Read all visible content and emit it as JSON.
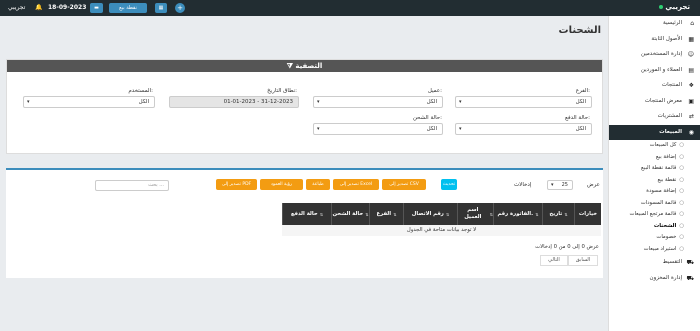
{
  "topbar": {
    "brand": "تجريبي",
    "user": "تجريبي",
    "date": "18-09-2023",
    "pos_label": "نقطة بيع"
  },
  "sidebar": {
    "items": [
      {
        "label": "الرئيسية",
        "icon": "home-icon",
        "glyph": "⌂"
      },
      {
        "label": "الأصول الثابتة",
        "icon": "building-icon",
        "glyph": "▦"
      },
      {
        "label": "إدارة المستخدمين",
        "icon": "users-icon",
        "glyph": "👥"
      },
      {
        "label": "العملاء و الموردين",
        "icon": "address-book-icon",
        "glyph": "▤"
      },
      {
        "label": "المنتجات",
        "icon": "cubes-icon",
        "glyph": "❖"
      },
      {
        "label": "معرض المنتجات",
        "icon": "gallery-icon",
        "glyph": "▣"
      },
      {
        "label": "المشتريات",
        "icon": "arrow-circle-icon",
        "glyph": "⇄"
      },
      {
        "label": "المبيعات",
        "icon": "sales-icon",
        "glyph": "◉"
      }
    ],
    "sub_items": [
      {
        "label": "كل المبيعات"
      },
      {
        "label": "إضافة بيع"
      },
      {
        "label": "قائمة نقطة البيع"
      },
      {
        "label": "نقطة بيع"
      },
      {
        "label": "إضافة مسودة"
      },
      {
        "label": "قائمة المسودات"
      },
      {
        "label": "قائمة مرتجع المبيعات"
      },
      {
        "label": "الشحنات"
      },
      {
        "label": "خصومات"
      },
      {
        "label": "استيراد مبيعات"
      }
    ],
    "bottom_items": [
      {
        "label": "التقسيط",
        "icon": "cart-icon",
        "glyph": "🛒"
      },
      {
        "label": "إدارة المخزون",
        "icon": "truck-icon",
        "glyph": "🚚"
      }
    ]
  },
  "page": {
    "title": "الشحنات"
  },
  "filter": {
    "heading": "التصفية",
    "location_label": "الفرع:",
    "location_value": "الكل",
    "customer_label": "عميل:",
    "customer_value": "الكل",
    "date_label": "نطاق التاريخ:",
    "date_value": "01-01-2023 - 31-12-2023",
    "user_label": "المستخدم:",
    "user_value": "الكل",
    "payment_status_label": "حالة الدفع:",
    "payment_status_value": "الكل",
    "shipping_status_label": "حالة الشحن:",
    "shipping_status_value": "الكل"
  },
  "table": {
    "show_label": "عرض",
    "page_size": "25",
    "entries_label": "إدخالات",
    "buttons": {
      "excel": "تصدير إلى Excel",
      "csv": "تصدير إلى CSV",
      "print": "طباعة",
      "visibility": "رؤية العمود",
      "pdf": "تصدير إلى PDF",
      "refresh": "تحديث"
    },
    "search_placeholder": "بحث ...",
    "columns": [
      "خيارات",
      "تاريخ",
      "الفاتورة رقم.",
      "اسم العميل",
      "رقم الاتصال",
      "الفرع",
      "حالة الشحن",
      "حالة الدفع"
    ],
    "empty_text": "لا توجد بيانات متاحة في الجدول",
    "info_text": "عرض 0 إلى 0 من 0 إدخالات",
    "prev_label": "السابق",
    "next_label": "التالي"
  },
  "colors": {
    "topbar": "#222d32",
    "accent": "#3c8dbc",
    "excel": "#f39c12",
    "csv": "#f39c12",
    "print": "#f39c12",
    "visibility": "#f39c12",
    "pdf": "#f39c12",
    "refresh": "#00c0ef"
  }
}
